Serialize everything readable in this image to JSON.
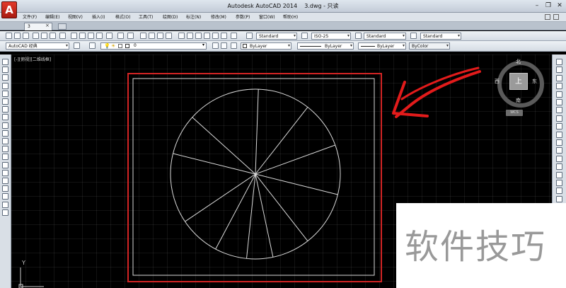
{
  "app": {
    "logo_letter": "A",
    "title": "Autodesk AutoCAD 2014",
    "file_name": "3.dwg",
    "read_only": "- 只读"
  },
  "window_controls": [
    "–",
    "❐",
    "✕"
  ],
  "menu": [
    "文件(F)",
    "编辑(E)",
    "视图(V)",
    "插入(I)",
    "格式(O)",
    "工具(T)",
    "绘图(D)",
    "标注(N)",
    "修改(M)",
    "参数(P)",
    "窗口(W)",
    "帮助(H)"
  ],
  "tabs": {
    "active": "3",
    "close": "×"
  },
  "toolbar": {
    "text_style": "Standard",
    "dim_style": "ISO-25",
    "table_style": "Standard",
    "multileader_style": "Standard",
    "workspace": "AutoCAD 经典",
    "layer": "0",
    "color": "ByLayer",
    "linetype": "ByLayer",
    "lineweight": "ByLayer",
    "plot_style": "ByColor"
  },
  "viewport_label": "[-][俯视][二维线框]",
  "viewcube": {
    "face": "上",
    "north": "北",
    "south": "南",
    "east": "东",
    "west": "西",
    "wcs": "WCS"
  },
  "ucs": {
    "y_label": "Y"
  },
  "watermark": "软件技巧",
  "colors": {
    "canvas": "#000000",
    "highlight_frame": "#d32424",
    "drawing_lines": "#d9d9d9",
    "arrow": "#e21b1b"
  },
  "drawing": {
    "pie_segments": 11
  }
}
